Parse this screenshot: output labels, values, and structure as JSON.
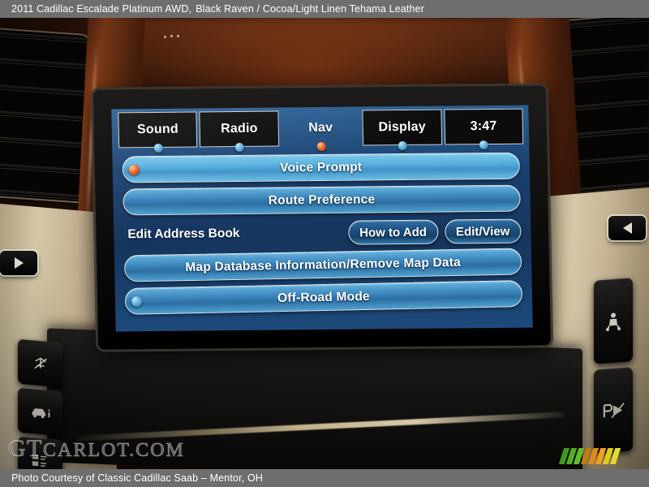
{
  "topbar": {
    "vehicle": "2011 Cadillac Escalade Platinum AWD,",
    "colors": "Black Raven / Cocoa/Light Linen Tehama Leather"
  },
  "footer": {
    "credit": "Photo Courtesy of Classic Cadillac Saab – Mentor, OH"
  },
  "watermark": {
    "g": "G",
    "t": "T",
    "rest": "CARLOT.COM"
  },
  "accent_colors": {
    "selected_dot": "#f06a24",
    "idle_dot": "#63b4da",
    "screen_blue": "#1b4170",
    "button_blue": "#3d87bd",
    "caption_bar": "#6e6e6e",
    "slash_green": "#3f9b1d",
    "slash_orange": "#e08a18",
    "slash_yellow": "#d9cc1a"
  },
  "nav_screen": {
    "tabs": [
      {
        "label": "Sound",
        "dot": "blue",
        "active": false
      },
      {
        "label": "Radio",
        "dot": "blue",
        "active": false
      },
      {
        "label": "Nav",
        "dot": "orange",
        "active": true
      },
      {
        "label": "Display",
        "dot": "blue",
        "active": false
      },
      {
        "label": "3:47",
        "dot": "blue",
        "active": false
      }
    ],
    "menu": {
      "voice_prompt": "Voice Prompt",
      "route_preference": "Route Preference",
      "address_book_label": "Edit Address Book",
      "how_to_add": "How to Add",
      "edit_view": "Edit/View",
      "map_database": "Map Database Information/Remove Map Data",
      "off_road_mode": "Off-Road Mode"
    }
  },
  "dash_controls": {
    "left_buttons": [
      {
        "icon": "rear-wiper-off-icon"
      },
      {
        "icon": "vehicle-info-icon"
      },
      {
        "icon": "display-grid-icon"
      }
    ],
    "right_buttons": [
      {
        "icon": "child-seat-icon"
      },
      {
        "icon": "parking-assist-off-icon"
      }
    ],
    "seek_left": "seek-left-button",
    "seek_right": "seek-right-button"
  }
}
